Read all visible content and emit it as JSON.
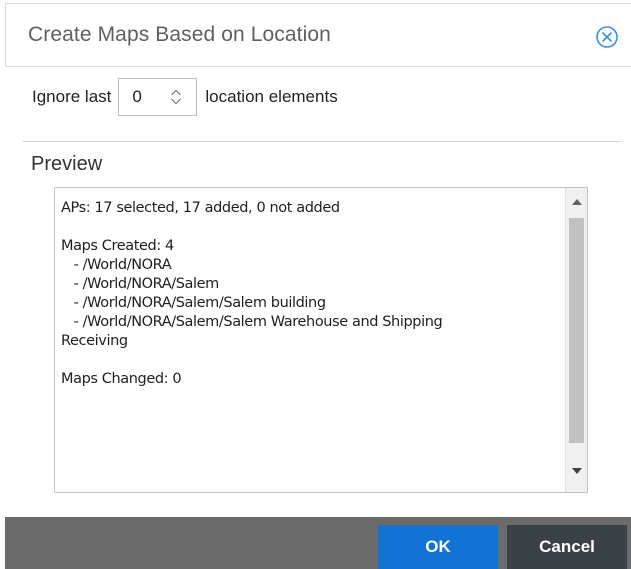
{
  "dialog": {
    "title": "Create Maps Based on Location",
    "close_icon": "close-circle-icon"
  },
  "ignore": {
    "prefix": "Ignore last",
    "value": "0",
    "suffix": "location elements"
  },
  "preview": {
    "label": "Preview",
    "lines": [
      "APs: 17 selected, 17 added, 0 not added",
      "",
      "Maps Created: 4",
      "   - /World/NORA",
      "   - /World/NORA/Salem",
      "   - /World/NORA/Salem/Salem building",
      "   - /World/NORA/Salem/Salem Warehouse and Shipping",
      "Receiving",
      "",
      "Maps Changed: 0"
    ]
  },
  "footer": {
    "ok_label": "OK",
    "cancel_label": "Cancel"
  },
  "colors": {
    "ok": "#1273d6",
    "cancel": "#3c4148",
    "footer": "#6b6b6b",
    "close_icon": "#3b8ee0"
  }
}
